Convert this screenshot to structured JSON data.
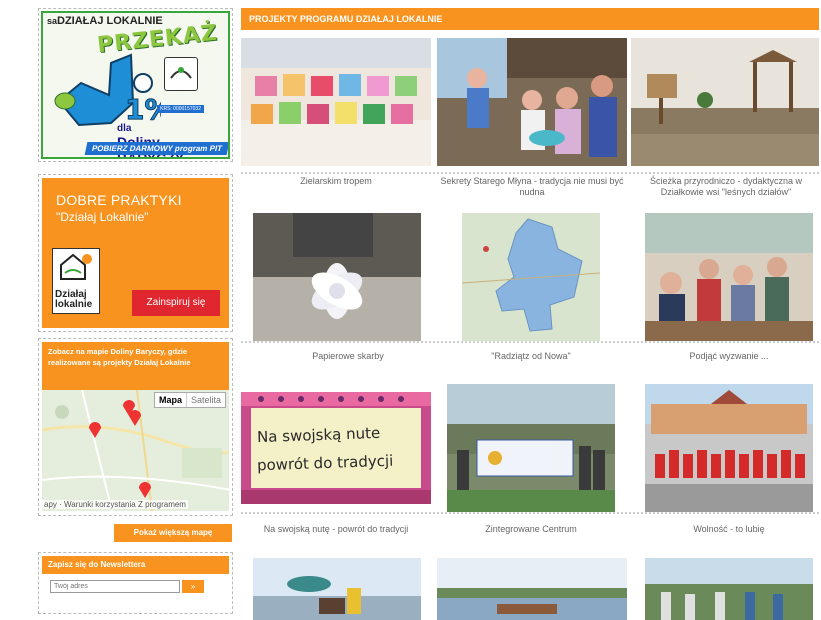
{
  "sidebar": {
    "promo": {
      "top_line": "DZIAŁAJ LOKALNIE",
      "top_prefix": "sa",
      "headline": "PRZEKAŻ",
      "amount": "1%",
      "for_label": "dla",
      "for_name": "Doliny BARYCZY",
      "krs": "KRS: 0000157032",
      "ribbon": "POBIERZ DARMOWY program PIT",
      "logo_text": "Dolina Baryczy"
    },
    "good_practices": {
      "title": "DOBRE PRAKTYKI",
      "subtitle": "\"Działaj Lokalnie\"",
      "logo_text": "Działaj lokalnie",
      "button": "Zainspiruj się"
    },
    "map": {
      "heading": "Zobacz na mapie Doliny Baryczy, gdzie realizowane są projekty Działaj Lokalnie",
      "toggle_map": "Mapa",
      "toggle_satellite": "Satelita",
      "footer": "apy · Warunki korzystania Z programem"
    },
    "bigger_map_button": "Pokaż większą mapę",
    "newsletter": {
      "heading": "Zapisz się do Newslettera",
      "placeholder": "Twój adres",
      "submit": "»"
    }
  },
  "main": {
    "section_title": "PROJEKTY PROGRAMU DZIAŁAJ LOKALNIE",
    "projects": [
      {
        "caption": "Zielarskim tropem",
        "icon": "potted-plants-photo"
      },
      {
        "caption": "Sekrety Starego Młyna - tradycja nie musi być nudna",
        "icon": "children-workshop-photo"
      },
      {
        "caption": "Ścieżka przyrodniczo - dydaktyczna w Działkowie wsi \"leśnych działów\"",
        "icon": "nature-trail-photo"
      },
      {
        "caption": "Papierowe skarby",
        "icon": "paper-flower-photo"
      },
      {
        "caption": "\"Radziątz od Nowa\"",
        "icon": "lake-map-photo"
      },
      {
        "caption": "Podjąć wyzwanie ...",
        "icon": "seniors-meeting-photo"
      },
      {
        "caption": "Na swojską nutę - powrót do tradycji",
        "icon": "folk-banner-photo"
      },
      {
        "caption": "Zintegrowane Centrum",
        "icon": "integration-group-photo"
      },
      {
        "caption": "Wolność - to lubię",
        "icon": "red-shirts-group-photo"
      },
      {
        "caption": "",
        "icon": "horse-event-photo"
      },
      {
        "caption": "",
        "icon": "lake-boat-photo"
      },
      {
        "caption": "",
        "icon": "outdoor-group-photo"
      }
    ],
    "photo_texts": {
      "folk_banner_line1": "Na swojską nute",
      "folk_banner_line2": "powrót do tradycji"
    }
  },
  "colors": {
    "accent_orange": "#f7931e",
    "button_red": "#e0262e",
    "promo_green": "#8dc63f"
  }
}
